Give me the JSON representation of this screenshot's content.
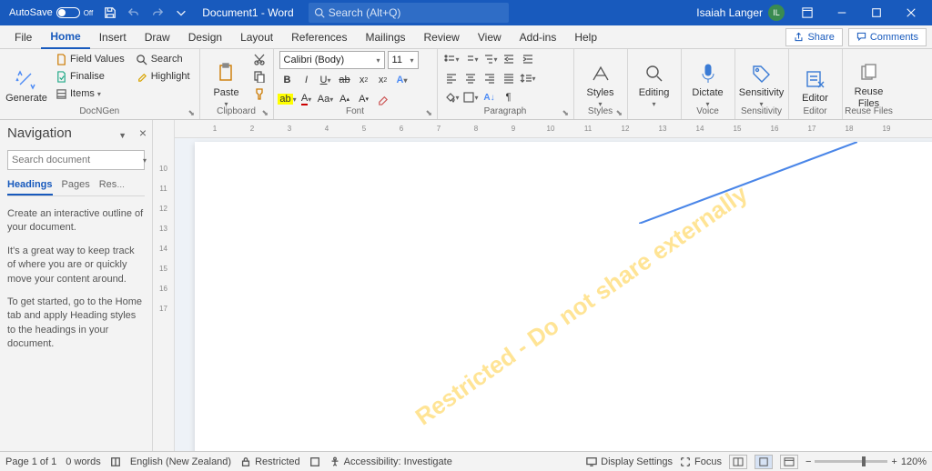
{
  "titlebar": {
    "autosave_label": "AutoSave",
    "autosave_state": "Off",
    "doc_title": "Document1 - Word",
    "search_placeholder": "Search (Alt+Q)",
    "user_name": "Isaiah Langer",
    "user_initials": "IL"
  },
  "tabs": {
    "items": [
      "File",
      "Home",
      "Insert",
      "Draw",
      "Design",
      "Layout",
      "References",
      "Mailings",
      "Review",
      "View",
      "Add-ins",
      "Help"
    ],
    "share": "Share",
    "comments": "Comments"
  },
  "ribbon": {
    "generate": {
      "label": "Generate",
      "group": "DocNGen"
    },
    "docngen": {
      "field_values": "Field Values",
      "finalise": "Finalise",
      "items": "Items",
      "search": "Search",
      "highlight": "Highlight"
    },
    "clipboard": {
      "paste": "Paste",
      "group": "Clipboard"
    },
    "font": {
      "name": "Calibri (Body)",
      "size": "11",
      "group": "Font"
    },
    "paragraph": {
      "group": "Paragraph"
    },
    "styles": {
      "label": "Styles",
      "group": "Styles"
    },
    "editing": {
      "label": "Editing"
    },
    "voice": {
      "label": "Dictate",
      "group": "Voice"
    },
    "sensitivity": {
      "label": "Sensitivity",
      "group": "Sensitivity"
    },
    "editor": {
      "label": "Editor",
      "group": "Editor"
    },
    "reuse": {
      "label": "Reuse Files",
      "group": "Reuse Files"
    }
  },
  "nav": {
    "title": "Navigation",
    "search_placeholder": "Search document",
    "tabs": [
      "Headings",
      "Pages",
      "Results"
    ],
    "help1": "Create an interactive outline of your document.",
    "help2": "It's a great way to keep track of where you are or quickly move your content around.",
    "help3": "To get started, go to the Home tab and apply Heading styles to the headings in your document."
  },
  "watermark": "Restricted - Do not share externally",
  "ruler_h": [
    "1",
    "2",
    "3",
    "4",
    "5",
    "6",
    "7",
    "8",
    "9",
    "10",
    "11",
    "12",
    "13",
    "14",
    "15",
    "16",
    "17",
    "18",
    "19"
  ],
  "ruler_v": [
    "",
    "10",
    "11",
    "12",
    "13",
    "14",
    "15",
    "16",
    "17"
  ],
  "status": {
    "page": "Page 1 of 1",
    "words": "0 words",
    "lang": "English (New Zealand)",
    "restricted": "Restricted",
    "accessibility": "Accessibility: Investigate",
    "display": "Display Settings",
    "focus": "Focus",
    "zoom": "120%"
  }
}
